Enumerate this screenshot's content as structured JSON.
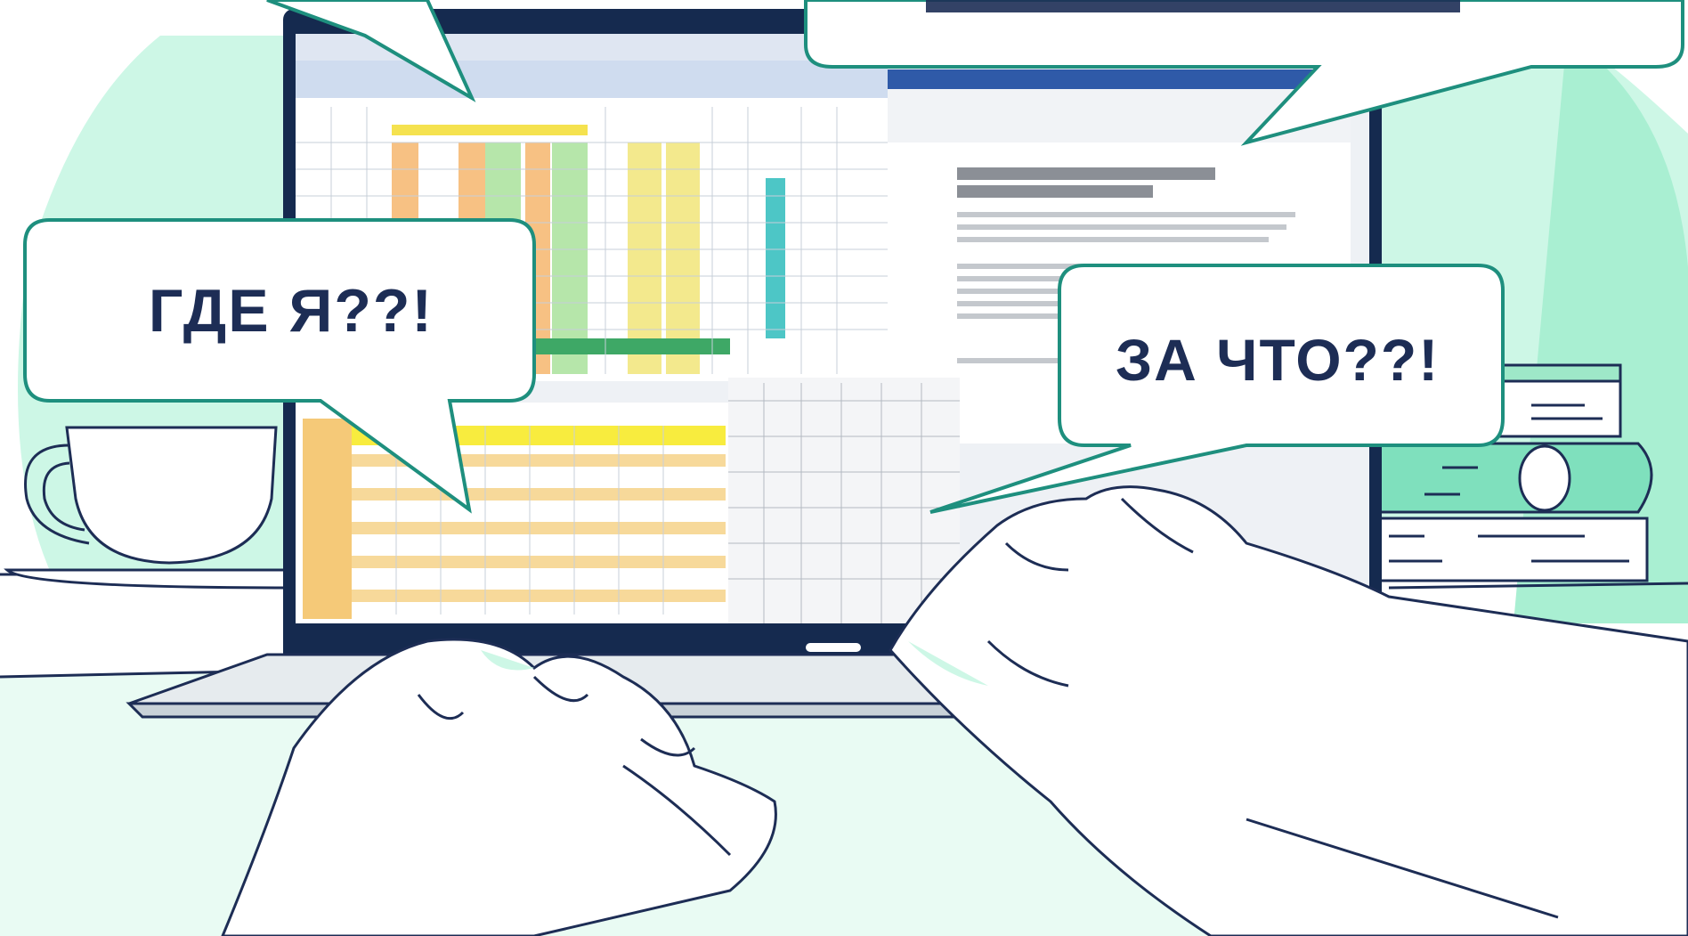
{
  "bubbles": {
    "left": {
      "text": "ГДЕ Я??!"
    },
    "right": {
      "text": "ЗА ЧТО??!"
    }
  },
  "colors": {
    "mint": "#cdf7e6",
    "mint_dark": "#7fe0bd",
    "teal_outline": "#1e8f7e",
    "navy": "#1d2d55",
    "laptop_frame": "#152a4f",
    "spreadsheet_yellow": "#f2e27a",
    "spreadsheet_orange": "#f0b46a",
    "spreadsheet_green": "#a6dca0"
  },
  "icons": [
    "coffee-cup-icon",
    "book-stack-icon",
    "laptop-icon",
    "hand-icon"
  ]
}
